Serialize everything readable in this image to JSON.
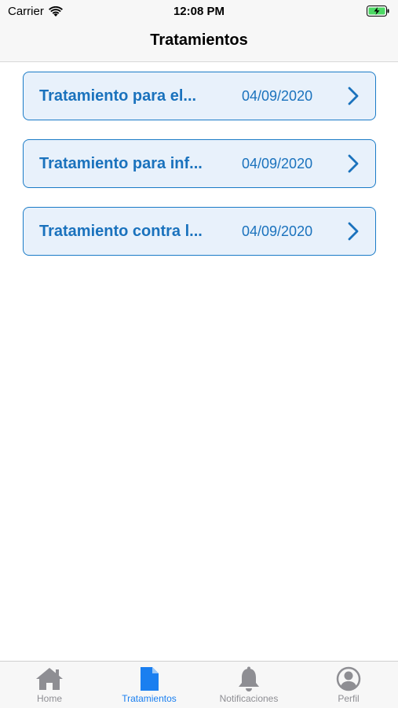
{
  "status_bar": {
    "carrier": "Carrier",
    "time": "12:08 PM",
    "battery_icon": "battery-charging-icon",
    "wifi_icon": "wifi-icon"
  },
  "nav": {
    "title": "Tratamientos"
  },
  "treatments": [
    {
      "title": "Tratamiento para el...",
      "date": "04/09/2020"
    },
    {
      "title": "Tratamiento para inf...",
      "date": "04/09/2020"
    },
    {
      "title": "Tratamiento contra l...",
      "date": "04/09/2020"
    }
  ],
  "tab_bar": {
    "tabs": [
      {
        "label": "Home",
        "icon": "home-icon",
        "active": false
      },
      {
        "label": "Tratamientos",
        "icon": "document-icon",
        "active": true
      },
      {
        "label": "Notificaciones",
        "icon": "bell-icon",
        "active": false
      },
      {
        "label": "Perfil",
        "icon": "profile-icon",
        "active": false
      }
    ]
  },
  "colors": {
    "accent": "#1a72bd",
    "card_background": "#e8f1fb",
    "tab_active": "#1a7ff0",
    "tab_inactive": "#8e8e93"
  }
}
